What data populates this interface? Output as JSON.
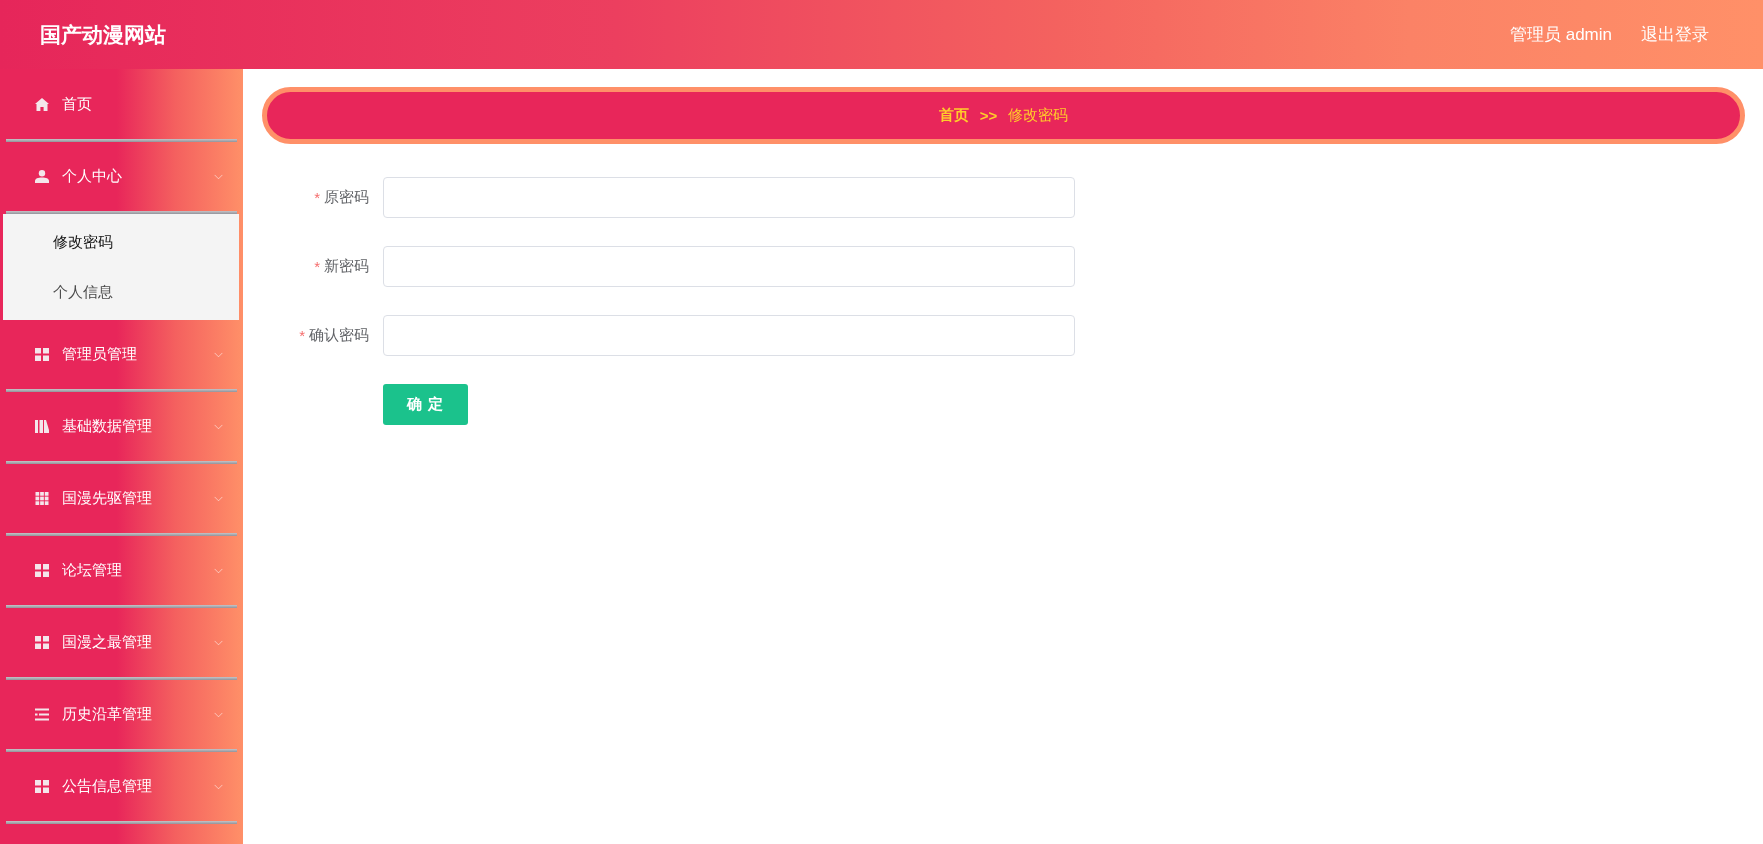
{
  "header": {
    "title": "国产动漫网站",
    "user": "管理员 admin",
    "logout": "退出登录"
  },
  "sidebar": {
    "items": [
      {
        "label": "首页"
      },
      {
        "label": "个人中心",
        "expanded": true,
        "children": [
          {
            "label": "修改密码",
            "selected": true
          },
          {
            "label": "个人信息",
            "selected": false
          }
        ]
      },
      {
        "label": "管理员管理",
        "expanded": false
      },
      {
        "label": "基础数据管理",
        "expanded": false
      },
      {
        "label": "国漫先驱管理",
        "expanded": false
      },
      {
        "label": "论坛管理",
        "expanded": false
      },
      {
        "label": "国漫之最管理",
        "expanded": false
      },
      {
        "label": "历史沿革管理",
        "expanded": false
      },
      {
        "label": "公告信息管理",
        "expanded": false
      }
    ]
  },
  "breadcrumb": {
    "items": [
      "首页",
      "修改密码"
    ],
    "separator": ">>"
  },
  "form": {
    "fields": [
      {
        "label": "原密码",
        "required_mark": "*"
      },
      {
        "label": "新密码",
        "required_mark": "*"
      },
      {
        "label": "确认密码",
        "required_mark": "*"
      }
    ],
    "submit": "确 定"
  }
}
